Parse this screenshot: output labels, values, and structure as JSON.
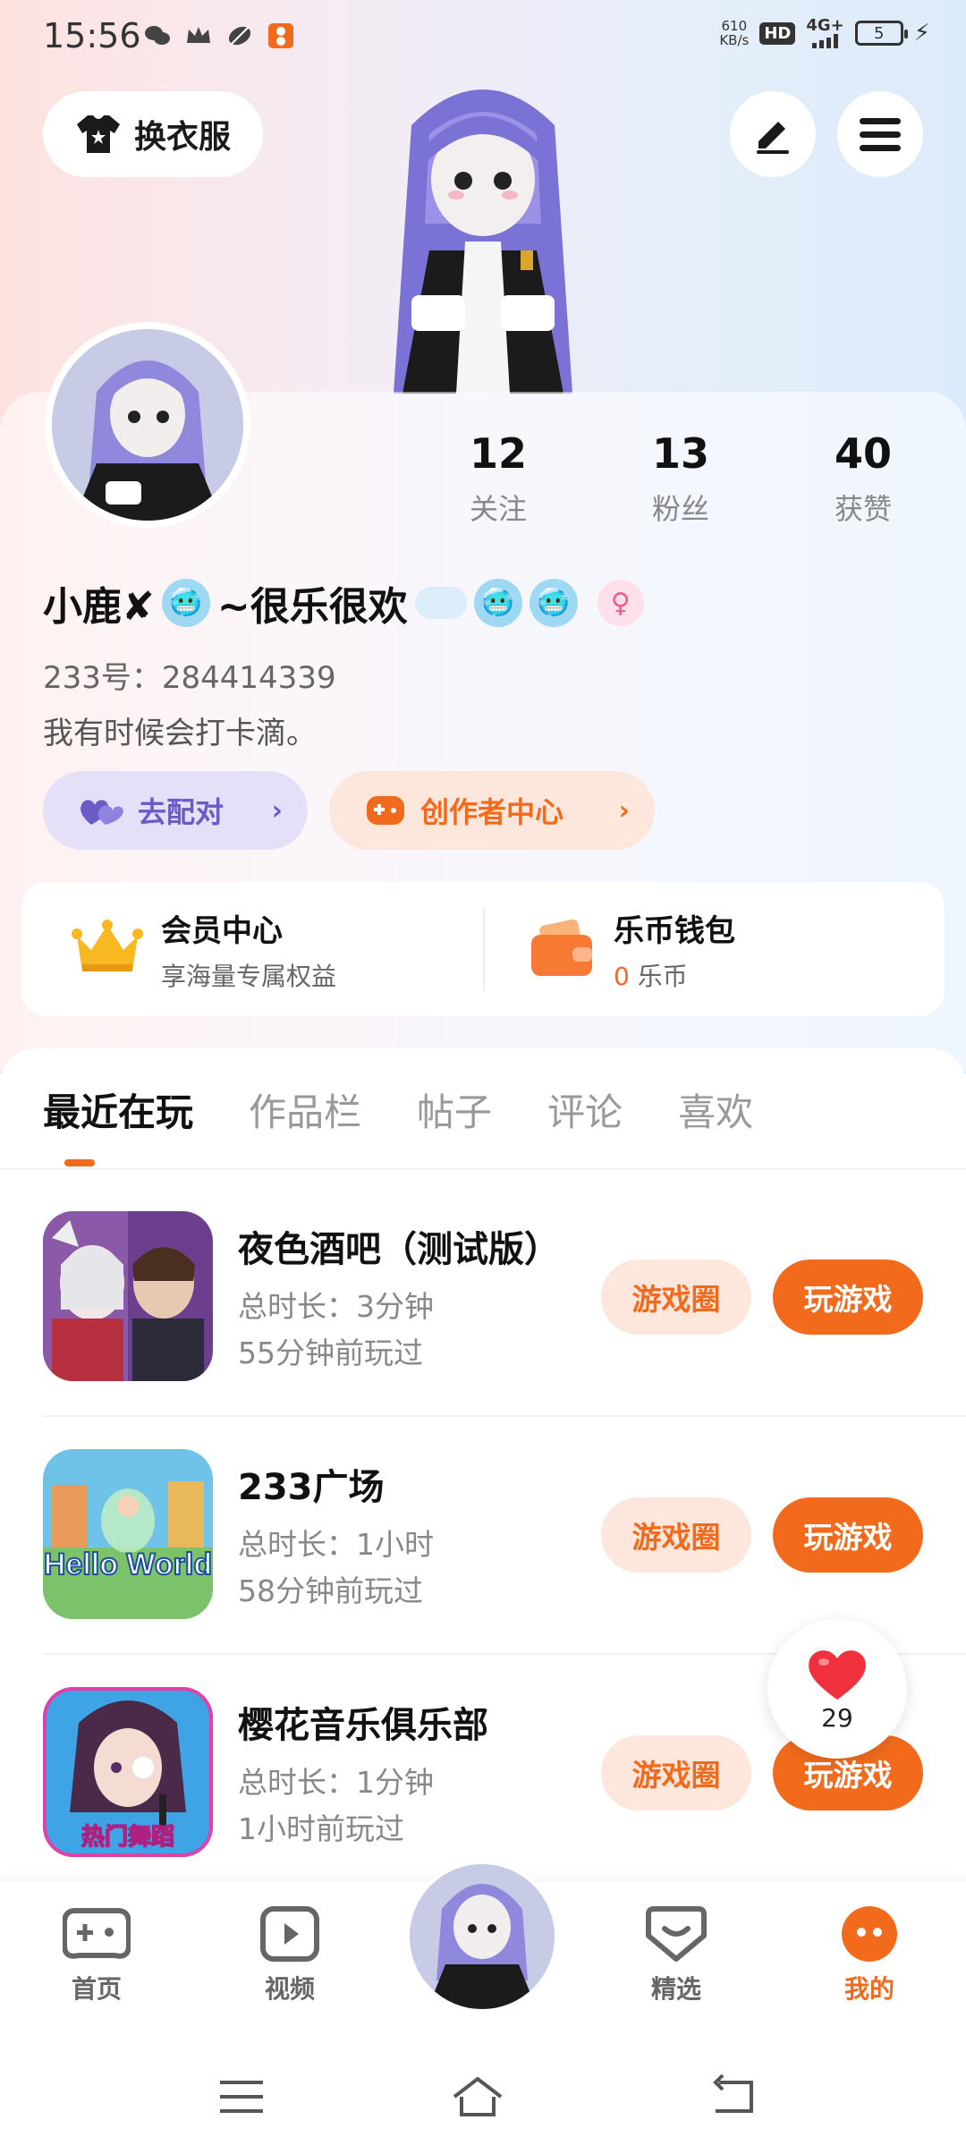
{
  "status_bar": {
    "time": "15:56",
    "net_speed_value": "610",
    "net_speed_unit": "KB/s",
    "hd": "HD",
    "network": "4G+",
    "battery": "5"
  },
  "header": {
    "outfit_label": "换衣服"
  },
  "profile": {
    "stats": [
      {
        "value": "12",
        "label": "关注"
      },
      {
        "value": "13",
        "label": "粉丝"
      },
      {
        "value": "40",
        "label": "获赞"
      }
    ],
    "name_part1": "小鹿✘",
    "name_part2": "~很乐很欢",
    "uid": "233号：284414339",
    "bio": "我有时候会打卡滴。",
    "match_label": "去配对",
    "creator_label": "创作者中心"
  },
  "member": {
    "vip_title": "会员中心",
    "vip_sub": "享海量专属权益",
    "wallet_title": "乐币钱包",
    "coin_count": "0",
    "coin_unit": " 乐币"
  },
  "tabs": [
    "最近在玩",
    "作品栏",
    "帖子",
    "评论",
    "喜欢"
  ],
  "games": [
    {
      "name": "夜色酒吧（测试版）",
      "duration": "总时长：3分钟",
      "last_played": "55分钟前玩过",
      "circle_label": "游戏圈",
      "play_label": "玩游戏"
    },
    {
      "name": "233广场",
      "duration": "总时长：1小时",
      "last_played": "58分钟前玩过",
      "circle_label": "游戏圈",
      "play_label": "玩游戏",
      "thumb_text": "Hello World"
    },
    {
      "name": "樱花音乐俱乐部",
      "duration": "总时长：1分钟",
      "last_played": "1小时前玩过",
      "circle_label": "游戏圈",
      "play_label": "玩游戏",
      "thumb_text": "热门舞蹈"
    }
  ],
  "like_float": {
    "count": "29"
  },
  "bottom_nav": [
    {
      "label": "首页",
      "icon": "gamepad-icon"
    },
    {
      "label": "视频",
      "icon": "video-icon"
    },
    {
      "label": "精选",
      "icon": "heart-chat-icon"
    },
    {
      "label": "我的",
      "icon": "profile-dots-icon"
    }
  ],
  "colors": {
    "accent": "#f26b1d",
    "match_purple": "#6a5cc7"
  }
}
